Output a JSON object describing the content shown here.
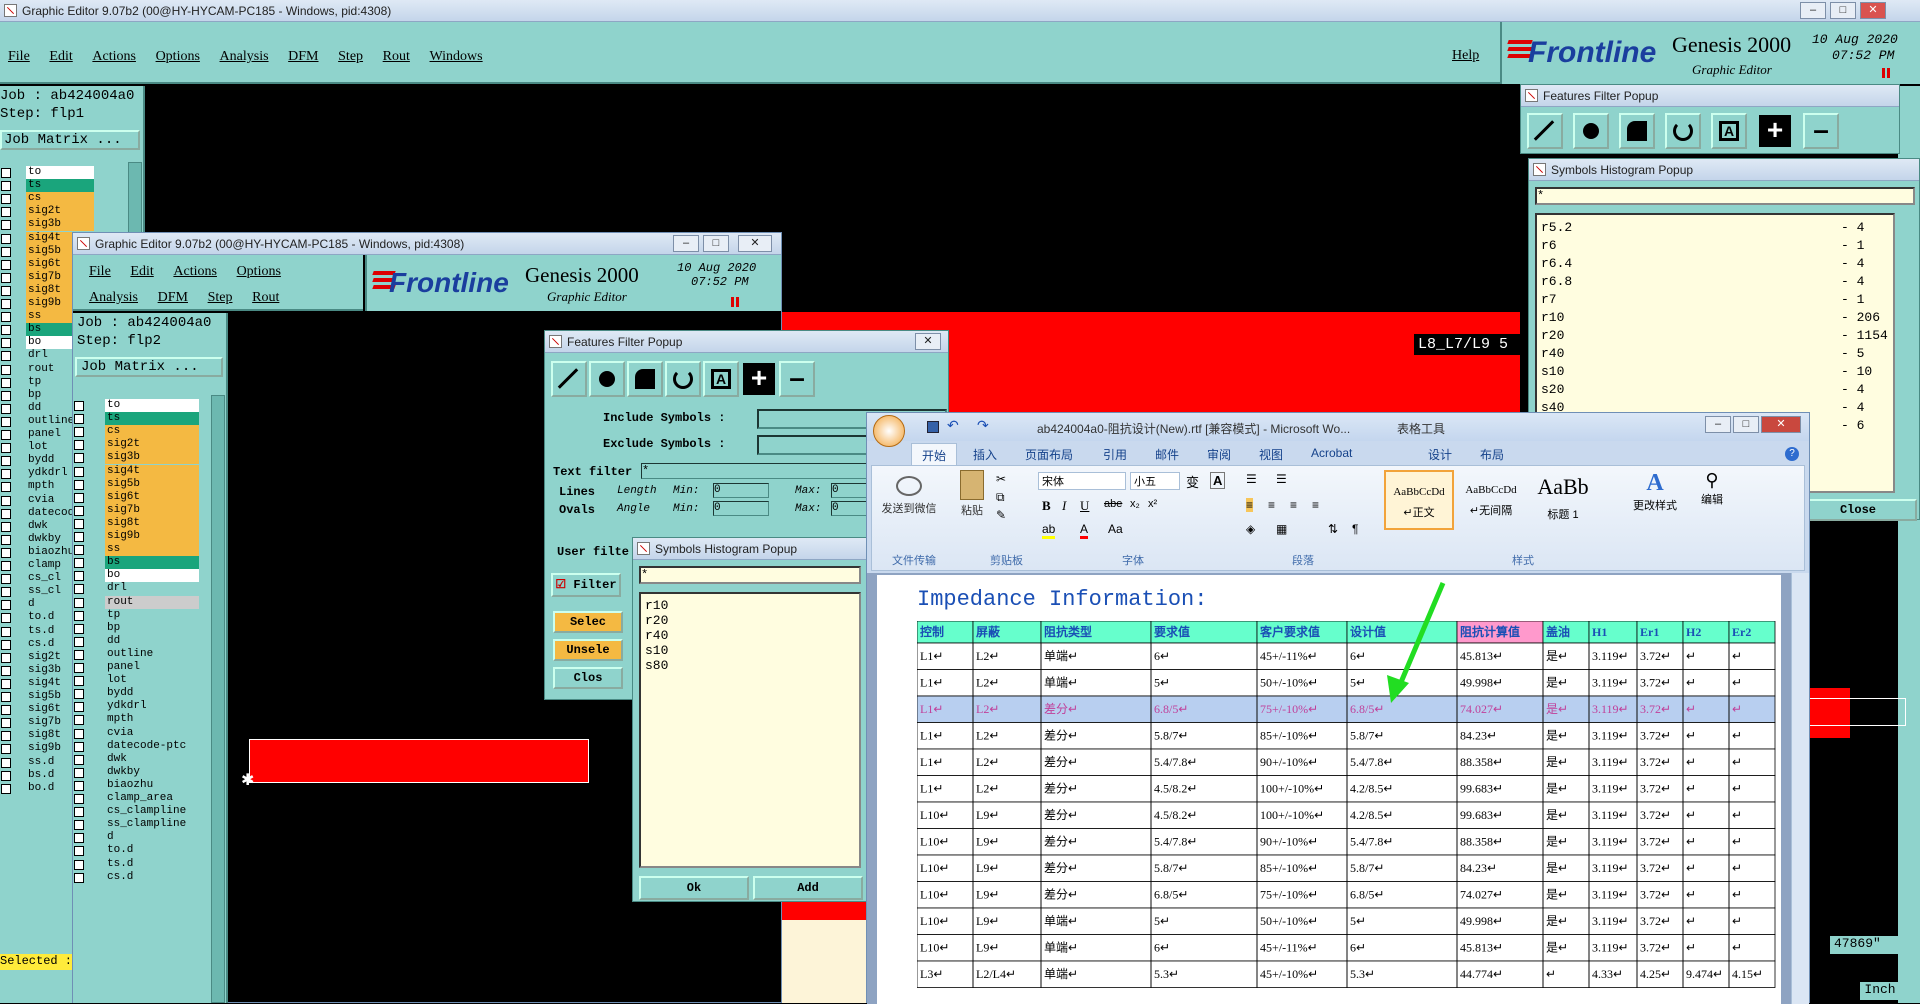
{
  "main_window": {
    "title": "Graphic Editor 9.07b2 (00@HY-HYCAM-PC185 - Windows, pid:4308)",
    "menu": [
      "File",
      "Edit",
      "Actions",
      "Options",
      "Analysis",
      "DFM",
      "Step",
      "Rout",
      "Windows"
    ],
    "help": "Help",
    "brand": "Frontline",
    "product": "Genesis 2000",
    "subtitle": "Graphic Editor",
    "date": "10 Aug 2020",
    "time": "07:52 PM",
    "job_label": "Job : ab424004a0",
    "step_label": "Step: flp1",
    "job_matrix": "Job Matrix ...",
    "layers": [
      "to",
      "ts",
      "cs",
      "sig2t",
      "sig3b",
      "sig4t",
      "sig5b",
      "sig6t",
      "sig7b",
      "sig8t",
      "sig9b",
      "ss",
      "bs",
      "bo",
      "drl",
      "rout",
      "tp",
      "bp",
      "dd",
      "outline",
      "panel",
      "lot",
      "bydd",
      "ydkdrl",
      "mpth",
      "cvia",
      "datecode",
      "dwk",
      "dwkby",
      "biaozhu",
      "clamp",
      "cs_cl",
      "ss_cl",
      "d",
      "to.d",
      "ts.d",
      "cs.d",
      "sig2t",
      "sig3b",
      "sig4t",
      "sig5b",
      "sig6t",
      "sig7b",
      "sig8t",
      "sig9b",
      "ss.d",
      "bs.d",
      "bo.d"
    ],
    "selected_label": "Selected :",
    "board_text": "L8_L7/L9 5",
    "coord_readout": "47869\"",
    "unit": "Inch"
  },
  "second_window": {
    "title": "Graphic Editor 9.07b2 (00@HY-HYCAM-PC185 - Windows, pid:4308)",
    "menu_row1": [
      "File",
      "Edit",
      "Actions",
      "Options"
    ],
    "menu_row2": [
      "Analysis",
      "DFM",
      "Step",
      "Rout"
    ],
    "brand": "Frontline",
    "product": "Genesis 2000",
    "subtitle": "Graphic Editor",
    "date": "10 Aug 2020",
    "time": "07:52 PM",
    "job_label": "Job : ab424004a0",
    "step_label": "Step: flp2",
    "job_matrix": "Job Matrix ...",
    "layers": [
      {
        "name": "to",
        "color": "#ffffff"
      },
      {
        "name": "ts",
        "color": "#1aa57c"
      },
      {
        "name": "cs",
        "color": "#f4b942"
      },
      {
        "name": "sig2t",
        "color": "#f4b942"
      },
      {
        "name": "sig3b",
        "color": "#f4b942"
      },
      {
        "name": "sig4t",
        "color": "#f4b942"
      },
      {
        "name": "sig5b",
        "color": "#f4b942"
      },
      {
        "name": "sig6t",
        "color": "#f4b942"
      },
      {
        "name": "sig7b",
        "color": "#f4b942"
      },
      {
        "name": "sig8t",
        "color": "#f4b942"
      },
      {
        "name": "sig9b",
        "color": "#f4b942"
      },
      {
        "name": "ss",
        "color": "#f4b942"
      },
      {
        "name": "bs",
        "color": "#1aa57c"
      },
      {
        "name": "bo",
        "color": "#ffffff"
      },
      {
        "name": "drl",
        "color": "#8fd3cc"
      },
      {
        "name": "rout",
        "color": "#cccccc"
      },
      {
        "name": "tp",
        "color": "#8fd3cc"
      },
      {
        "name": "bp",
        "color": "#8fd3cc"
      },
      {
        "name": "dd",
        "color": "#8fd3cc"
      },
      {
        "name": "outline",
        "color": "#8fd3cc"
      },
      {
        "name": "panel",
        "color": "#8fd3cc"
      },
      {
        "name": "lot",
        "color": "#8fd3cc"
      },
      {
        "name": "bydd",
        "color": "#8fd3cc"
      },
      {
        "name": "ydkdrl",
        "color": "#8fd3cc"
      },
      {
        "name": "mpth",
        "color": "#8fd3cc"
      },
      {
        "name": "cvia",
        "color": "#8fd3cc"
      },
      {
        "name": "datecode-ptc",
        "color": "#8fd3cc"
      },
      {
        "name": "dwk",
        "color": "#8fd3cc"
      },
      {
        "name": "dwkby",
        "color": "#8fd3cc"
      },
      {
        "name": "biaozhu",
        "color": "#8fd3cc"
      },
      {
        "name": "clamp_area",
        "color": "#8fd3cc"
      },
      {
        "name": "cs_clampline",
        "color": "#8fd3cc"
      },
      {
        "name": "ss_clampline",
        "color": "#8fd3cc"
      },
      {
        "name": "d",
        "color": "#8fd3cc"
      },
      {
        "name": "to.d",
        "color": "#8fd3cc"
      },
      {
        "name": "ts.d",
        "color": "#8fd3cc"
      },
      {
        "name": "cs.d",
        "color": "#8fd3cc"
      }
    ]
  },
  "features_filter_small": {
    "title": "Features Filter Popup",
    "include_symbols": "Include Symbols :",
    "exclude_symbols": "Exclude Symbols :",
    "text_filter": "Text filter",
    "text_filter_value": "*",
    "lines": "Lines",
    "ovals": "Ovals",
    "length": "Length",
    "angle": "Angle",
    "min": "Min:",
    "max": "Max:",
    "zero": "0",
    "user_filter": "User filte",
    "filter_btn": "Filter",
    "select_btn": "Selec",
    "unselect_btn": "Unsele",
    "close_btn": "Clos"
  },
  "symbols_histogram_small": {
    "title": "Symbols Histogram Popup",
    "filter_value": "*",
    "items": [
      "r10",
      "r20",
      "r40",
      "s10",
      "s80"
    ],
    "ok": "Ok",
    "add": "Add"
  },
  "features_filter_right": {
    "title": "Features Filter Popup"
  },
  "symbols_histogram_right": {
    "title": "Symbols Histogram Popup",
    "filter_value": "*",
    "items": [
      {
        "name": "r5.2",
        "count": "4"
      },
      {
        "name": "r6",
        "count": "1"
      },
      {
        "name": "r6.4",
        "count": "4"
      },
      {
        "name": "r6.8",
        "count": "4"
      },
      {
        "name": "r7",
        "count": "1"
      },
      {
        "name": "r10",
        "count": "206"
      },
      {
        "name": "r20",
        "count": "1154"
      },
      {
        "name": "r40",
        "count": "5"
      },
      {
        "name": "s10",
        "count": "10"
      },
      {
        "name": "s20",
        "count": "4"
      },
      {
        "name": "s40",
        "count": "4"
      },
      {
        "name": "",
        "count": "6"
      }
    ],
    "close": "Close"
  },
  "word": {
    "title": "ab424004a0-阻抗设计(New).rtf [兼容模式] - Microsoft Wo...",
    "context_tab": "表格工具",
    "tabs": [
      "开始",
      "插入",
      "页面布局",
      "引用",
      "邮件",
      "审阅",
      "视图",
      "Acrobat",
      "设计",
      "布局"
    ],
    "font_name": "宋体",
    "font_size": "小五",
    "groups": [
      "文件传输",
      "剪贴板",
      "字体",
      "段落",
      "样式"
    ],
    "send_wechat": "发送到微信",
    "paste": "粘贴",
    "styles": [
      {
        "preview": "AaBbCcDd",
        "name": "↵正文"
      },
      {
        "preview": "AaBbCcDd",
        "name": "↵无间隔"
      },
      {
        "preview": "AaBb",
        "name": "标题 1"
      }
    ],
    "change_styles": "更改样式",
    "edit": "编辑",
    "doc_heading": "Impedance Information:",
    "table_headers": [
      "控制",
      "屏蔽",
      "阻抗类型",
      "要求值",
      "客户要求值",
      "设计值",
      "阻抗计算值",
      "盖油",
      "H1",
      "Er1",
      "H2",
      "Er2"
    ],
    "rows": [
      [
        "L1",
        "L2",
        "单端",
        "6",
        "45+/-11%",
        "6",
        "45.813",
        "是",
        "3.119",
        "3.72",
        "",
        ""
      ],
      [
        "L1",
        "L2",
        "单端",
        "5",
        "50+/-10%",
        "5",
        "49.998",
        "是",
        "3.119",
        "3.72",
        "",
        ""
      ],
      [
        "L1",
        "L2",
        "差分",
        "6.8/5",
        "75+/-10%",
        "6.8/5",
        "74.027",
        "是",
        "3.119",
        "3.72",
        "",
        ""
      ],
      [
        "L1",
        "L2",
        "差分",
        "5.8/7",
        "85+/-10%",
        "5.8/7",
        "84.23",
        "是",
        "3.119",
        "3.72",
        "",
        ""
      ],
      [
        "L1",
        "L2",
        "差分",
        "5.4/7.8",
        "90+/-10%",
        "5.4/7.8",
        "88.358",
        "是",
        "3.119",
        "3.72",
        "",
        ""
      ],
      [
        "L1",
        "L2",
        "差分",
        "4.5/8.2",
        "100+/-10%",
        "4.2/8.5",
        "99.683",
        "是",
        "3.119",
        "3.72",
        "",
        ""
      ],
      [
        "L10",
        "L9",
        "差分",
        "4.5/8.2",
        "100+/-10%",
        "4.2/8.5",
        "99.683",
        "是",
        "3.119",
        "3.72",
        "",
        ""
      ],
      [
        "L10",
        "L9",
        "差分",
        "5.4/7.8",
        "90+/-10%",
        "5.4/7.8",
        "88.358",
        "是",
        "3.119",
        "3.72",
        "",
        ""
      ],
      [
        "L10",
        "L9",
        "差分",
        "5.8/7",
        "85+/-10%",
        "5.8/7",
        "84.23",
        "是",
        "3.119",
        "3.72",
        "",
        ""
      ],
      [
        "L10",
        "L9",
        "差分",
        "6.8/5",
        "75+/-10%",
        "6.8/5",
        "74.027",
        "是",
        "3.119",
        "3.72",
        "",
        ""
      ],
      [
        "L10",
        "L9",
        "单端",
        "5",
        "50+/-10%",
        "5",
        "49.998",
        "是",
        "3.119",
        "3.72",
        "",
        ""
      ],
      [
        "L10",
        "L9",
        "单端",
        "6",
        "45+/-11%",
        "6",
        "45.813",
        "是",
        "3.119",
        "3.72",
        "",
        ""
      ],
      [
        "L3",
        "L2/L4",
        "单端",
        "5.3",
        "45+/-10%",
        "5.3",
        "44.774",
        "",
        "4.33",
        "4.25",
        "9.474",
        "4.15"
      ]
    ],
    "highlight_row": 2,
    "accent": "#1a4fb5"
  }
}
